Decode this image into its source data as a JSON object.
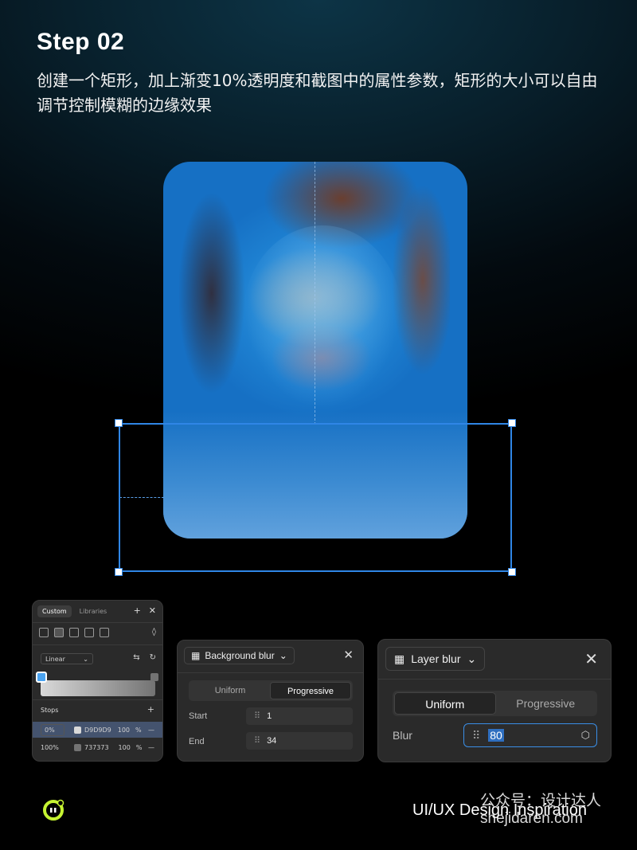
{
  "header": {
    "title": "Step 02",
    "subtitle": "创建一个矩形，加上渐变10%透明度和截图中的属性参数，矩形的大小可以自由调节控制模糊的边缘效果"
  },
  "fill_panel": {
    "tabs": [
      "Custom",
      "Libraries"
    ],
    "gradient_type": "Linear",
    "stops_label": "Stops",
    "stops": [
      {
        "position": "0%",
        "hex": "D9D9D9",
        "opacity": "100",
        "unit": "%",
        "color": "#d9d9d9"
      },
      {
        "position": "100%",
        "hex": "737373",
        "opacity": "100",
        "unit": "%",
        "color": "#737373"
      }
    ]
  },
  "bg_blur_panel": {
    "title": "Background blur",
    "modes": [
      "Uniform",
      "Progressive"
    ],
    "active_mode": "Progressive",
    "start_label": "Start",
    "start_value": "1",
    "end_label": "End",
    "end_value": "34"
  },
  "layer_blur_panel": {
    "title": "Layer blur",
    "modes": [
      "Uniform",
      "Progressive"
    ],
    "active_mode": "Uniform",
    "blur_label": "Blur",
    "blur_value": "80"
  },
  "footer": {
    "brand": "UI/UX Design Inspiration",
    "watermark_line1": "公众号：设计达人",
    "watermark_line2": "shejidaren.com"
  },
  "colors": {
    "accent": "#2f86e6",
    "logo_lime": "#c6f432"
  }
}
